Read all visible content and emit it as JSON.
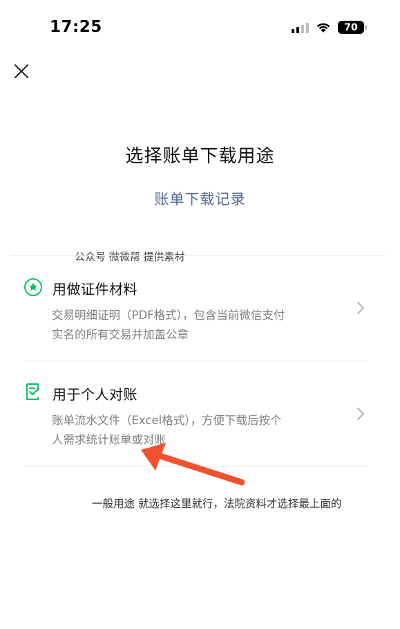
{
  "status_bar": {
    "time": "17:25",
    "battery": "70"
  },
  "header": {
    "close_icon": "close-icon"
  },
  "main": {
    "title": "选择账单下载用途",
    "history_link": "账单下载记录",
    "watermark": "公众号 微微帮 提供素材",
    "options": [
      {
        "icon": "star-badge-icon",
        "title": "用做证件材料",
        "desc_line1": "交易明细证明（PDF格式），包含当前微信支付",
        "desc_line2": "实名的所有交易并加盖公章"
      },
      {
        "icon": "document-check-icon",
        "title": "用于个人对账",
        "desc_line1": "账单流水文件（Excel格式），方便下载后按个",
        "desc_line2": "人需求统计账单或对账"
      }
    ],
    "annotation": "一般用途 就选择这里就行，法院资料才选择最上面的"
  },
  "colors": {
    "accent_green": "#07c160",
    "link_blue": "#576b95",
    "arrow_red": "#f0522f"
  }
}
